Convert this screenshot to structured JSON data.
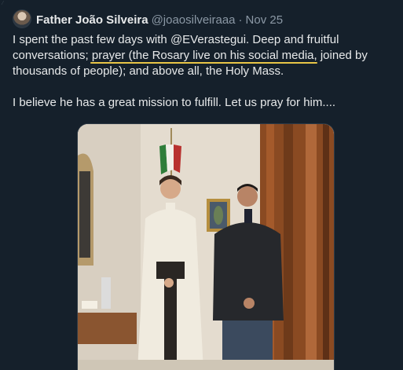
{
  "tweet": {
    "author": {
      "display_name": "Father João Silveira",
      "handle": "@joaosilveiraaa"
    },
    "separator": "·",
    "date": "Nov 25",
    "text": {
      "part1": "I spent the past few days with @EVerastegui. Deep and fruitful conversations; ",
      "highlight": "prayer (the Rosary live on his social media",
      "part2": ", joined by thousands of people); and above all, the Holy Mass.",
      "para2": "I believe he has a great mission to fulfill. Let us pray for him...."
    },
    "media": {
      "description_icon": "photo-icon"
    }
  },
  "colors": {
    "background": "#15202b",
    "text": "#e7e9ea",
    "muted": "#8b98a5",
    "highlight_underline": "#e8c547"
  }
}
